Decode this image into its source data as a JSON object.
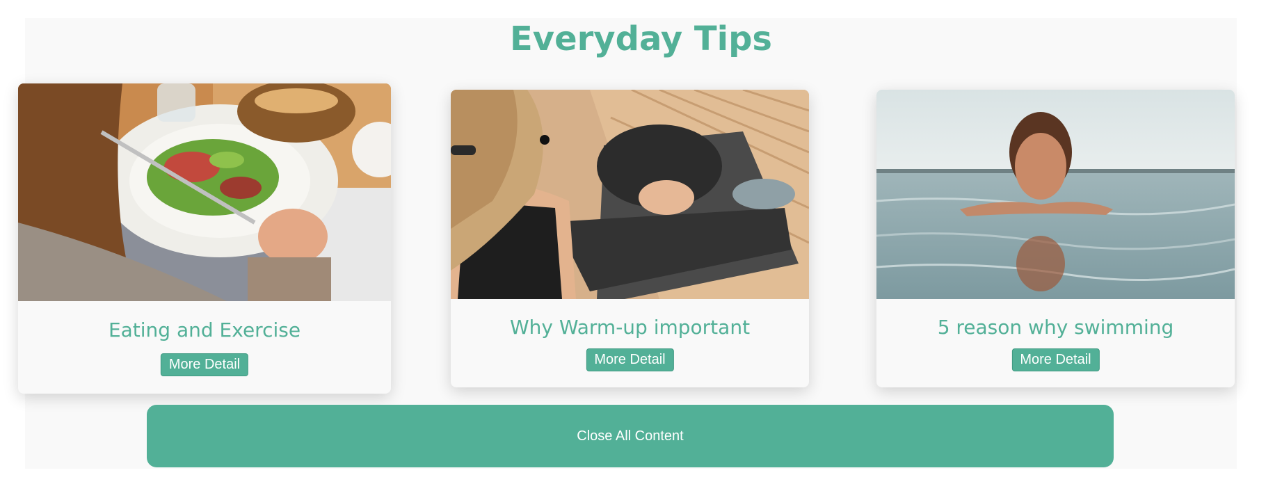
{
  "header": {
    "title": "Everyday Tips"
  },
  "cards": [
    {
      "title": "Eating and Exercise",
      "button_label": "More Detail",
      "image": "salad-eating-photo"
    },
    {
      "title": "Why Warm-up important",
      "button_label": "More Detail",
      "image": "stretching-workout-photo"
    },
    {
      "title": "5 reason why swimming",
      "button_label": "More Detail",
      "image": "woman-swimming-photo"
    }
  ],
  "footer": {
    "close_label": "Close All Content"
  },
  "colors": {
    "accent": "#52b097",
    "panel": "#f9f9f9",
    "text_on_accent": "#ffffff"
  }
}
